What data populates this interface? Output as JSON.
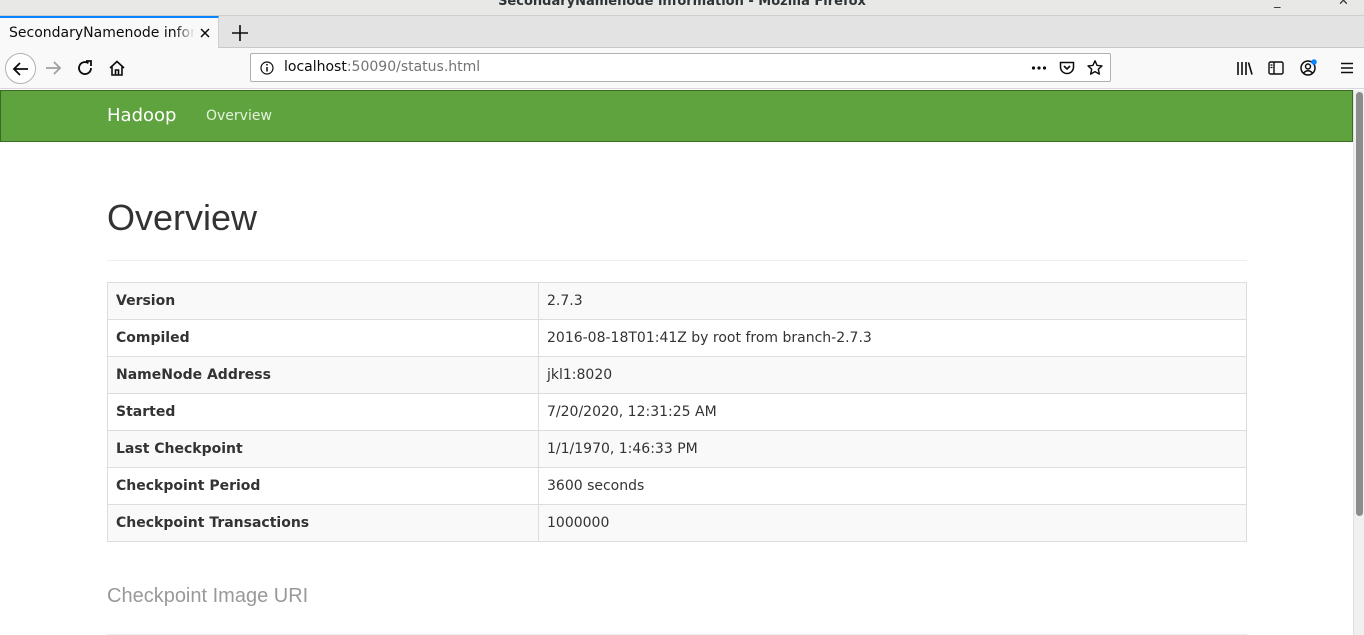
{
  "window": {
    "title": "SecondaryNamenode information - Mozilla Firefox"
  },
  "tabs": [
    {
      "label": "SecondaryNamenode information"
    }
  ],
  "navbar": {
    "url_host": "localhost",
    "url_rest": ":50090/status.html"
  },
  "page": {
    "brand": "Hadoop",
    "nav_link": "Overview",
    "heading": "Overview",
    "section_heading": "Checkpoint Image URI",
    "info_rows": [
      {
        "key": "Version",
        "value": "2.7.3"
      },
      {
        "key": "Compiled",
        "value": "2016-08-18T01:41Z by root from branch-2.7.3"
      },
      {
        "key": "NameNode Address",
        "value": "jkl1:8020"
      },
      {
        "key": "Started",
        "value": "7/20/2020, 12:31:25 AM"
      },
      {
        "key": "Last Checkpoint",
        "value": "1/1/1970, 1:46:33 PM"
      },
      {
        "key": "Checkpoint Period",
        "value": "3600 seconds"
      },
      {
        "key": "Checkpoint Transactions",
        "value": "1000000"
      }
    ]
  },
  "colors": {
    "navbar_green": "#5fa33e",
    "tab_accent": "#0a84ff"
  },
  "icons": [
    "close-icon",
    "plus-icon",
    "back-arrow-icon",
    "forward-arrow-icon",
    "reload-icon",
    "home-icon",
    "info-icon",
    "more-icon",
    "pocket-icon",
    "star-icon",
    "library-icon",
    "sidebar-icon",
    "account-icon",
    "menu-icon",
    "minimize-icon"
  ]
}
